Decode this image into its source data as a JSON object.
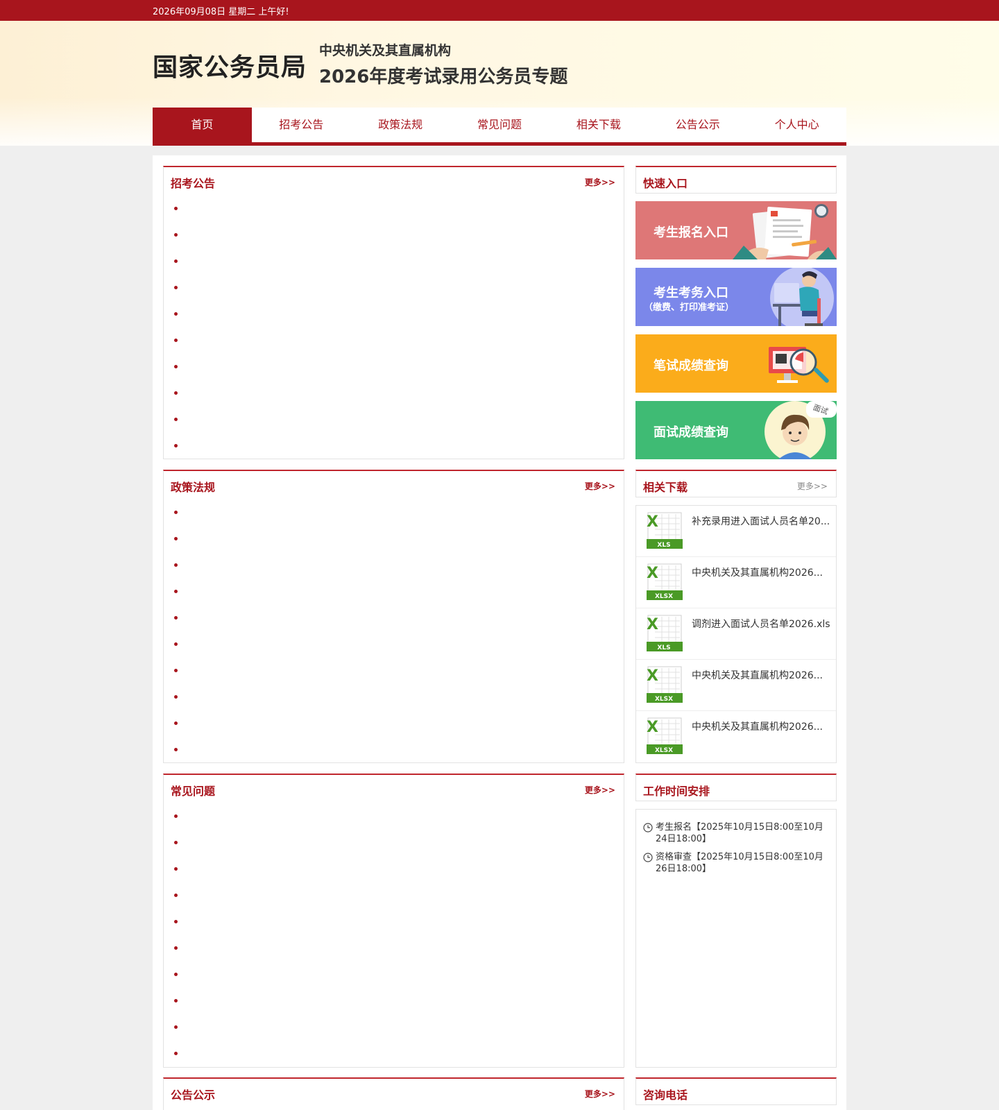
{
  "topbar": {
    "date": "2026年09月08日  星期二  上午好!"
  },
  "header": {
    "logo": "国家公务员局",
    "subtitle1": "中央机关及其直属机构",
    "subtitle2": "2026年度考试录用公务员专题"
  },
  "nav": {
    "items": [
      "首页",
      "招考公告",
      "政策法规",
      "常见问题",
      "相关下载",
      "公告公示",
      "个人中心"
    ],
    "active_index": 0
  },
  "sections": {
    "announcements": {
      "title": "招考公告",
      "more": "更多>>"
    },
    "policies": {
      "title": "政策法规",
      "more": "更多>>"
    },
    "faq": {
      "title": "常见问题",
      "more": "更多>>"
    },
    "notices": {
      "title": "公告公示",
      "more": "更多>>"
    }
  },
  "quick_entry": {
    "title": "快速入口",
    "buttons": [
      {
        "label": "考生报名入口",
        "color": "#de7777"
      },
      {
        "label": "考生考务入口",
        "note": "（缴费、打印准考证）",
        "color": "#7b87ea"
      },
      {
        "label": "笔试成绩查询",
        "color": "#fbac1b"
      },
      {
        "label": "面试成绩查询",
        "color": "#3fbb74"
      }
    ],
    "badge": "面试"
  },
  "downloads": {
    "title": "相关下载",
    "more": "更多>>",
    "items": [
      {
        "name": "补充录用进入面试人员名单20...",
        "type": "XLS"
      },
      {
        "name": "中央机关及其直属机构2026...",
        "type": "XLSX"
      },
      {
        "name": "调剂进入面试人员名单2026.xls",
        "type": "XLS"
      },
      {
        "name": "中央机关及其直属机构2026...",
        "type": "XLSX"
      },
      {
        "name": "中央机关及其直属机构2026...",
        "type": "XLSX"
      }
    ]
  },
  "schedule": {
    "title": "工作时间安排",
    "items": [
      "考生报名【2025年10月15日8:00至10月24日18:00】",
      "资格审查【2025年10月15日8:00至10月26日18:00】"
    ]
  },
  "contact": {
    "title": "咨询电话"
  },
  "colors": {
    "brand": "#a8151d",
    "accent_line": "#c0262d",
    "excel_green": "#4a9a26"
  }
}
